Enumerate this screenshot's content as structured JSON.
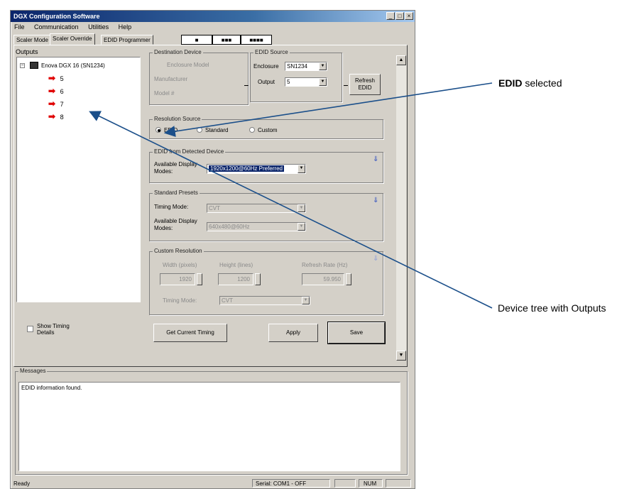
{
  "window": {
    "title": "DGX Configuration Software",
    "minimize": "_",
    "maximize": "□",
    "close": "×"
  },
  "menu": [
    "File",
    "Communication",
    "Utilities",
    "Help"
  ],
  "tabs": [
    "Scaler Mode",
    "Scaler Override",
    "EDID Programmer",
    "■",
    "■■■",
    "■■■■"
  ],
  "outputs": {
    "label": "Outputs",
    "root": "Enova DGX 16 (SN1234)",
    "items": [
      "5",
      "6",
      "7",
      "8"
    ]
  },
  "show_timing": "Show Timing Details",
  "destination": {
    "label": "Destination Device",
    "line1": "Enclosure Model",
    "line2": "Manufacturer",
    "line3": "Model #"
  },
  "edid_source": {
    "label": "EDID Source",
    "enclosure_label": "Enclosure",
    "enclosure_value": "SN1234",
    "output_label": "Output",
    "output_value": "5",
    "refresh": "Refresh EDID"
  },
  "resolution_source": {
    "label": "Resolution Source",
    "options": [
      "EDID",
      "Standard",
      "Custom"
    ]
  },
  "edid_detected": {
    "label": "EDID from Detected Device",
    "available_label": "Available Display Modes:",
    "mode_value": "1920x1200@60Hz Preferred"
  },
  "standard_presets": {
    "label": "Standard Presets",
    "timing_label": "Timing Mode:",
    "timing_value": "CVT",
    "available_label": "Available Display Modes:",
    "modes_value": "640x480@60Hz"
  },
  "custom_resolution": {
    "label": "Custom Resolution",
    "width_label": "Width (pixels)",
    "width_value": "1920",
    "height_label": "Height (lines)",
    "height_value": "1200",
    "refresh_label": "Refresh Rate (Hz)",
    "refresh_value": "59.950",
    "timing_label": "Timing Mode:",
    "timing_value": "CVT"
  },
  "buttons": {
    "get_current": "Get Current Timing",
    "apply": "Apply",
    "save": "Save"
  },
  "messages": {
    "label": "Messages",
    "text": "EDID information found."
  },
  "statusbar": {
    "ready": "Ready",
    "serial": "Serial: COM1 - OFF",
    "num": "NUM"
  },
  "callouts": {
    "edid_bold": "EDID",
    "edid_rest": " selected",
    "tree": "Device tree with Outputs"
  },
  "colors": {
    "callout_line": "#1b4f8a",
    "title_bar": "#0a246a",
    "arrow": "#e00000"
  }
}
